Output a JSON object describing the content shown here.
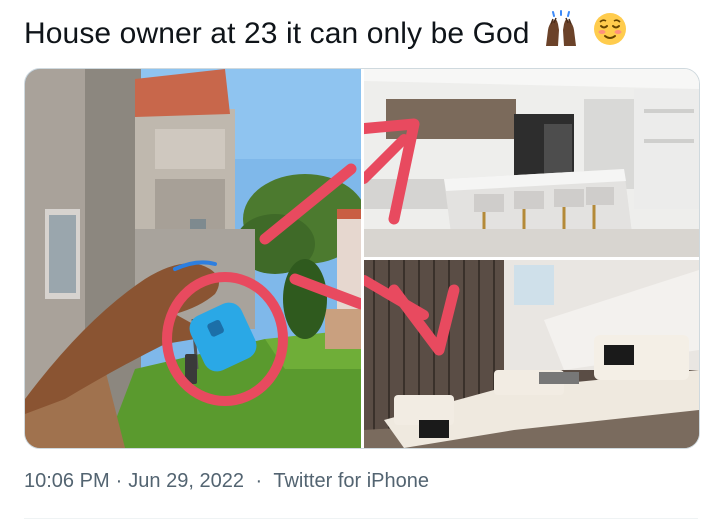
{
  "tweet": {
    "text": "House owner at 23 it can only be God",
    "emojis": [
      "raised-hands-dark-skin-icon",
      "relieved-face-icon"
    ]
  },
  "media": {
    "photos": [
      {
        "subject": "hand-holding-key-icon"
      },
      {
        "subject": "kitchen-photo"
      },
      {
        "subject": "living-room-photo"
      }
    ],
    "annotation_color": "#e84a5f"
  },
  "meta": {
    "time": "10:06 PM",
    "separator": "·",
    "date": "Jun 29, 2022",
    "source": "Twitter for iPhone"
  },
  "colors": {
    "text": "#0f1419",
    "secondary": "#536471",
    "border": "#cfd9de"
  }
}
